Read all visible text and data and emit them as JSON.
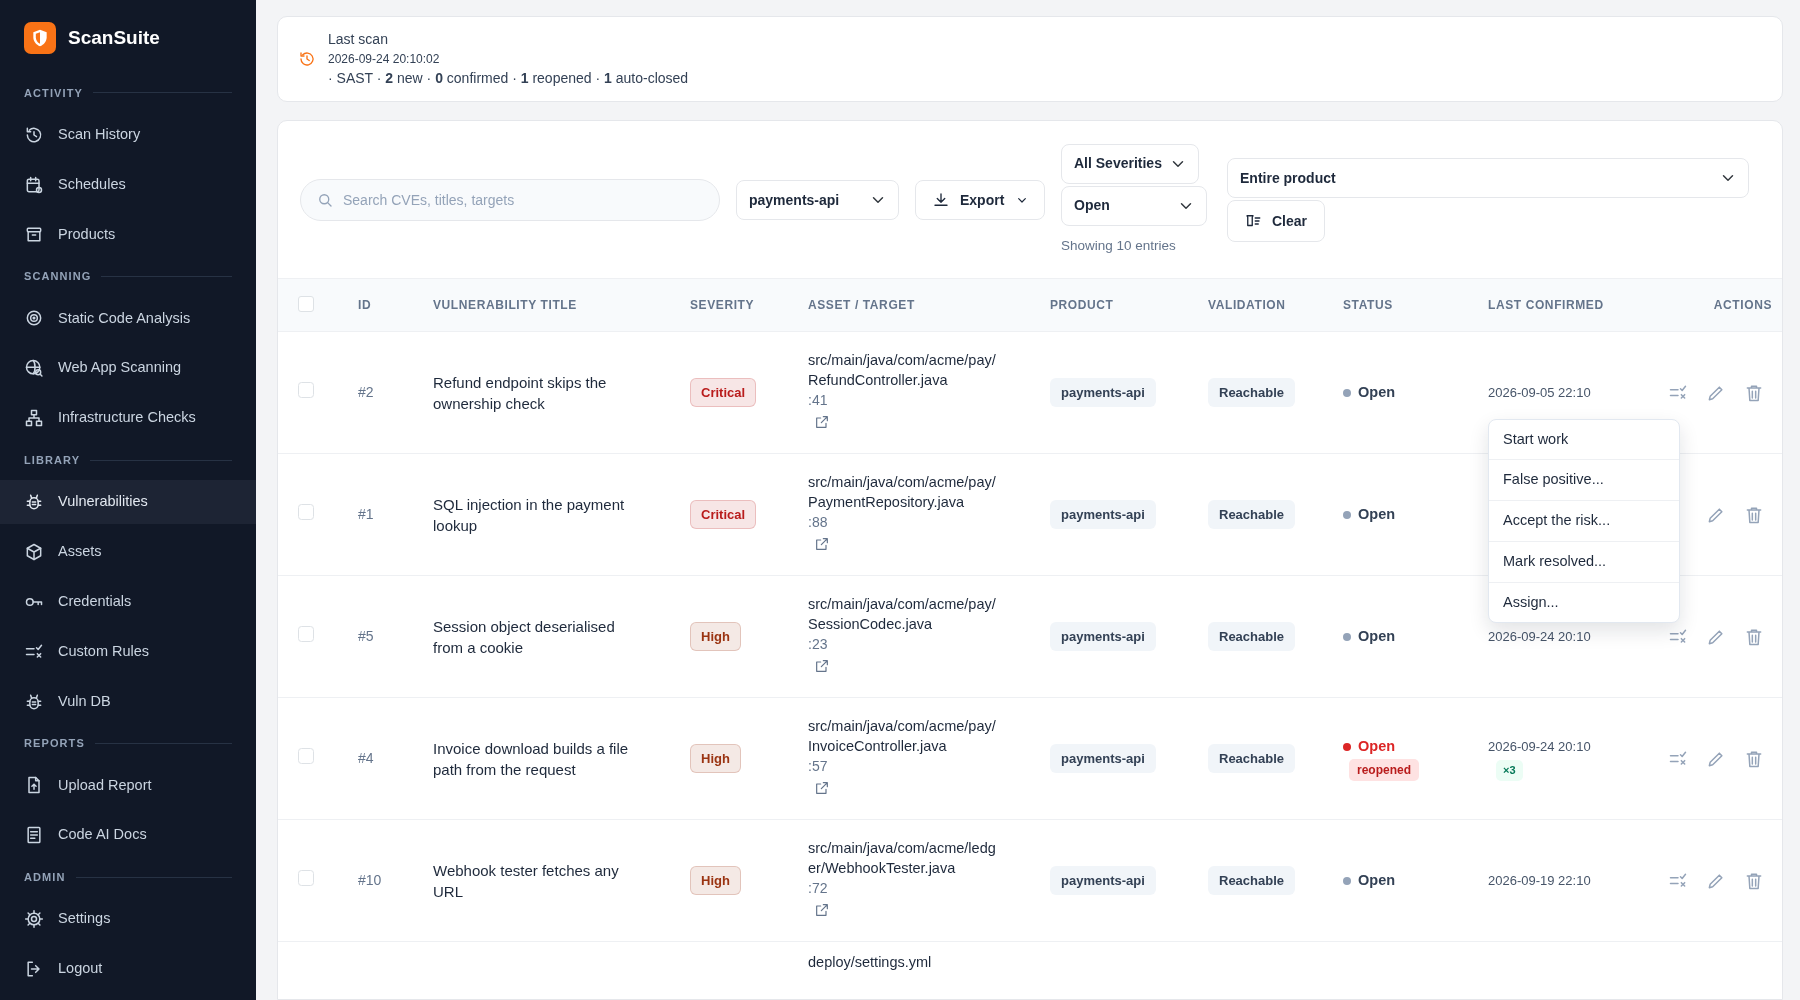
{
  "sidebar": {
    "brand": "ScanSuite",
    "sections": [
      {
        "title": "ACTIVITY",
        "items": [
          {
            "label": "Scan History",
            "selected": false
          },
          {
            "label": "Schedules",
            "selected": false
          },
          {
            "label": "Products",
            "selected": false
          }
        ]
      },
      {
        "title": "SCANNING",
        "items": [
          {
            "label": "Static Code Analysis",
            "selected": false
          },
          {
            "label": "Web App Scanning",
            "selected": false
          },
          {
            "label": "Infrastructure Checks",
            "selected": false
          }
        ]
      },
      {
        "title": "LIBRARY",
        "items": [
          {
            "label": "Vulnerabilities",
            "selected": true
          },
          {
            "label": "Assets",
            "selected": false
          },
          {
            "label": "Credentials",
            "selected": false
          },
          {
            "label": "Custom Rules",
            "selected": false
          },
          {
            "label": "Vuln DB",
            "selected": false
          }
        ]
      },
      {
        "title": "REPORTS",
        "items": [
          {
            "label": "Upload Report",
            "selected": false
          },
          {
            "label": "Code AI Docs",
            "selected": false
          }
        ]
      },
      {
        "title": "ADMIN",
        "items": [
          {
            "label": "Settings",
            "selected": false
          }
        ]
      }
    ],
    "footer_item": {
      "label": "Logout"
    }
  },
  "last_scan": {
    "title": "Last scan",
    "time": "2026-09-24 20:10:02",
    "summary": "· SAST · **2** new · **0** confirmed · **1** reopened · **1** auto-closed"
  },
  "filters": {
    "search": {
      "placeholder": "Search CVEs, titles, targets"
    },
    "product": "payments-api",
    "export": "Export",
    "severity": "All Severities",
    "status": "Open",
    "showing": "Showing 10 entries",
    "scope": "Entire product",
    "clear": "Clear"
  },
  "table": {
    "header_checked": false,
    "columns": [
      "ID",
      "VULNERABILITY TITLE",
      "SEVERITY",
      "ASSET / TARGET",
      "PRODUCT",
      "VALIDATION",
      "STATUS",
      "LAST CONFIRMED",
      "ACTIONS"
    ],
    "rows": [
      {
        "checked": false,
        "id": "#2",
        "title": "Refund endpoint skips the ownership check",
        "severity": "Critical",
        "color": "#b91c1c",
        "asset": "src/main/java/com/acme/pay/RefundController.java",
        "line": ":41",
        "product": "payments-api",
        "validation": "Reachable",
        "status": {
          "label": "Open",
          "color": "#94a3b8",
          "alert": false
        },
        "last_confirmed": "2026-09-05 22:10",
        "actions": [
          {
            "kind": "triage"
          },
          {
            "kind": "edit"
          },
          {
            "kind": "delete"
          }
        ]
      },
      {
        "checked": false,
        "id": "#1",
        "title": "SQL injection in the payment lookup",
        "severity": "Critical",
        "color": "#b91c1c",
        "asset": "src/main/java/com/acme/pay/PaymentRepository.java",
        "line": ":88",
        "product": "payments-api",
        "validation": "Reachable",
        "status": {
          "label": "Open",
          "color": "#94a3b8",
          "alert": false
        },
        "actions": [
          {
            "kind": "edit"
          },
          {
            "kind": "delete"
          }
        ]
      },
      {
        "checked": false,
        "id": "#5",
        "title": "Session object deserialised from a cookie",
        "severity": "High",
        "color": "#9a3412",
        "asset": "src/main/java/com/acme/pay/SessionCodec.java",
        "line": ":23",
        "product": "payments-api",
        "validation": "Reachable",
        "status": {
          "label": "Open",
          "color": "#94a3b8",
          "alert": false
        },
        "last_confirmed": "2026-09-24 20:10",
        "actions": [
          {
            "kind": "triage"
          },
          {
            "kind": "edit"
          },
          {
            "kind": "delete"
          }
        ]
      },
      {
        "checked": false,
        "id": "#4",
        "title": "Invoice download builds a file path from the request",
        "severity": "High",
        "color": "#9a3412",
        "asset": "src/main/java/com/acme/pay/InvoiceController.java",
        "line": ":57",
        "product": "payments-api",
        "validation": "Reachable",
        "status": {
          "label": "Open",
          "color": "#dc2626",
          "alert": true,
          "tag": "reopened"
        },
        "last_confirmed": "2026-09-24 20:10",
        "confirm_count": "×3",
        "actions": [
          {
            "kind": "triage"
          },
          {
            "kind": "edit"
          },
          {
            "kind": "delete"
          }
        ]
      },
      {
        "checked": false,
        "id": "#10",
        "title": "Webhook tester fetches any URL",
        "severity": "High",
        "color": "#9a3412",
        "asset": "src/main/java/com/acme/ledger/WebhookTester.java",
        "line": ":72",
        "product": "payments-api",
        "validation": "Reachable",
        "status": {
          "label": "Open",
          "color": "#94a3b8",
          "alert": false
        },
        "last_confirmed": "2026-09-19 22:10",
        "actions": [
          {
            "kind": "triage"
          },
          {
            "kind": "edit"
          },
          {
            "kind": "delete"
          }
        ]
      },
      {
        "asset": "deploy/settings.yml"
      }
    ],
    "action_menu": {
      "items": [
        "Start work",
        "False positive...",
        "Accept the risk...",
        "Mark resolved...",
        "Assign..."
      ]
    }
  }
}
